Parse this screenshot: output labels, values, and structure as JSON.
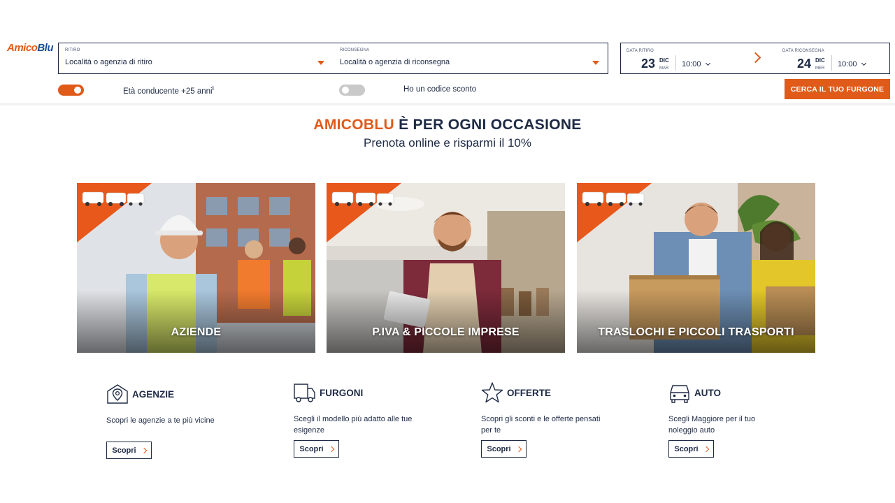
{
  "brand": {
    "part1": "Amico",
    "part2": "Blu"
  },
  "search": {
    "pickup_label": "RITIRO",
    "pickup_value": "Località o agenzia di ritiro",
    "return_label": "RICONSEGNA",
    "return_value": "Località o agenzia di riconsegna",
    "pickup_date": {
      "label": "DATA RITIRO",
      "day": "23",
      "month": "DIC",
      "weekday": "MAR",
      "time": "10:00"
    },
    "return_date": {
      "label": "DATA RICONSEGNA",
      "day": "24",
      "month": "DIC",
      "weekday": "MER",
      "time": "10:00"
    },
    "age_label": "Età conducente +25 anni",
    "age_info": "i",
    "age_on": true,
    "discount_label": "Ho un codice sconto",
    "discount_on": false,
    "cta": "CERCA IL TUO FURGONE"
  },
  "hero": {
    "accent": "AMICOBLU",
    "rest": " È PER OGNI OCCASIONE",
    "subtitle": "Prenota online e risparmi il 10%"
  },
  "cards": [
    {
      "title": "AZIENDE"
    },
    {
      "title": "P.IVA & PICCOLE IMPRESE"
    },
    {
      "title": "TRASLOCHI E PICCOLI TRASPORTI"
    }
  ],
  "features": [
    {
      "icon": "map-pin-icon",
      "title": "AGENZIE",
      "desc": "Scopri le agenzie a te più vicine",
      "button": "Scopri"
    },
    {
      "icon": "truck-icon",
      "title": "FURGONI",
      "desc": "Scegli il modello più adatto alle tue esigenze",
      "button": "Scopri"
    },
    {
      "icon": "star-icon",
      "title": "OFFERTE",
      "desc": "Scopri gli sconti e le offerte pensati per te",
      "button": "Scopri"
    },
    {
      "icon": "car-icon",
      "title": "AUTO",
      "desc": "Scegli Maggiore per il tuo noleggio auto",
      "button": "Scopri"
    }
  ],
  "colors": {
    "accent": "#e05a1a",
    "navy": "#1e2a45",
    "brand_blue": "#1d4c9a"
  }
}
